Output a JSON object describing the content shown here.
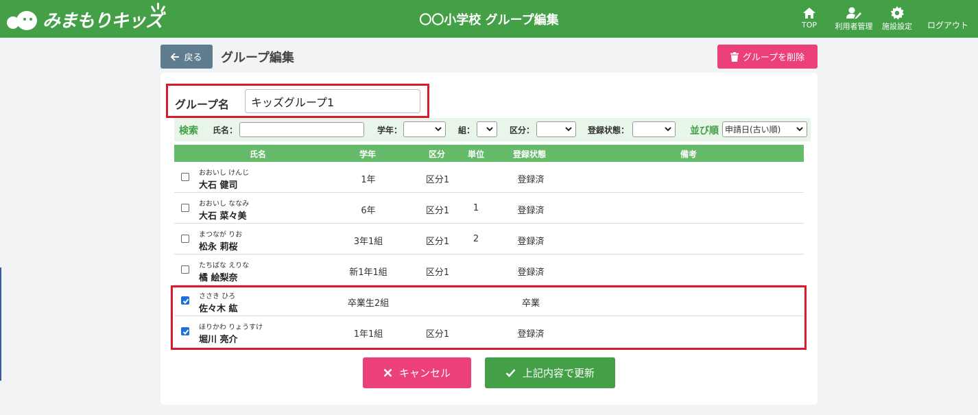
{
  "header": {
    "logo_text": "みまもりキッズ",
    "title": "〇〇小学校 グループ編集",
    "nav": {
      "top": "TOP",
      "users": "利用者管理",
      "settings": "施設設定",
      "logout": "ログアウト"
    }
  },
  "toolbar": {
    "back_label": "戻る",
    "page_title": "グループ編集",
    "delete_label": "グループを削除"
  },
  "group": {
    "name_label": "グループ名",
    "name_value": "キッズグループ1"
  },
  "search": {
    "label": "検索",
    "name_label": "氏名：",
    "name_value": "",
    "grade_label": "学年：",
    "grade_value": "",
    "class_label": "組：",
    "class_value": "",
    "division_label": "区分：",
    "division_value": "",
    "status_label": "登録状態：",
    "status_value": "",
    "sort_label": "並び順",
    "sort_value": "申請日(古い順)"
  },
  "table": {
    "headers": {
      "name": "氏名",
      "grade": "学年",
      "division": "区分",
      "unit": "単位",
      "status": "登録状態",
      "note": "備考"
    },
    "rows": [
      {
        "checked": false,
        "kana": "おおいし けんじ",
        "name": "大石 健司",
        "grade": "1年",
        "division": "区分1",
        "unit": "",
        "status": "登録済",
        "note": ""
      },
      {
        "checked": false,
        "kana": "おおいし ななみ",
        "name": "大石 菜々美",
        "grade": "6年",
        "division": "区分1",
        "unit": "1",
        "status": "登録済",
        "note": ""
      },
      {
        "checked": false,
        "kana": "まつなが りお",
        "name": "松永 莉桜",
        "grade": "3年1組",
        "division": "区分1",
        "unit": "2",
        "status": "登録済",
        "note": ""
      },
      {
        "checked": false,
        "kana": "たちばな えりな",
        "name": "橘 絵梨奈",
        "grade": "新1年1組",
        "division": "区分1",
        "unit": "",
        "status": "登録済",
        "note": ""
      },
      {
        "checked": true,
        "kana": "ささき ひろ",
        "name": "佐々木 紘",
        "grade": "卒業生2組",
        "division": "",
        "unit": "",
        "status": "卒業",
        "note": ""
      },
      {
        "checked": true,
        "kana": "ほりかわ りょうすけ",
        "name": "堀川 亮介",
        "grade": "1年1組",
        "division": "区分1",
        "unit": "",
        "status": "登録済",
        "note": ""
      }
    ]
  },
  "actions": {
    "cancel_label": "キャンセル",
    "update_label": "上記内容で更新"
  },
  "colors": {
    "header_green": "#43a047",
    "accent_pink": "#ec407a",
    "table_header_green": "#66bb6a",
    "highlight_red": "#d81b2c",
    "back_button": "#5f7d8e"
  }
}
